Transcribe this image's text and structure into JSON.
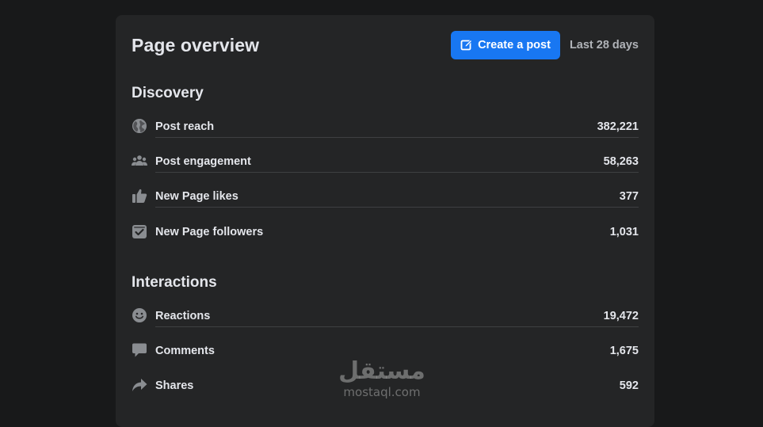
{
  "header": {
    "title": "Page overview",
    "create_button": "Create a post",
    "date_range": "Last 28 days"
  },
  "discovery": {
    "title": "Discovery",
    "items": [
      {
        "label": "Post reach",
        "value": "382,221",
        "icon": "globe-icon"
      },
      {
        "label": "Post engagement",
        "value": "58,263",
        "icon": "people-icon"
      },
      {
        "label": "New Page likes",
        "value": "377",
        "icon": "thumbs-up-icon"
      },
      {
        "label": "New Page followers",
        "value": "1,031",
        "icon": "follow-check-icon"
      }
    ]
  },
  "interactions": {
    "title": "Interactions",
    "items": [
      {
        "label": "Reactions",
        "value": "19,472",
        "icon": "smiley-icon"
      },
      {
        "label": "Comments",
        "value": "1,675",
        "icon": "comment-icon"
      },
      {
        "label": "Shares",
        "value": "592",
        "icon": "share-icon"
      }
    ]
  },
  "watermark": {
    "arabic": "مستقل",
    "latin": "mostaql.com"
  },
  "colors": {
    "background": "#18191a",
    "card": "#242526",
    "accent": "#1877f2",
    "text": "#e4e6eb",
    "secondary_text": "#b0b3b8",
    "divider": "#3e4042",
    "icon": "#8a8d91"
  }
}
